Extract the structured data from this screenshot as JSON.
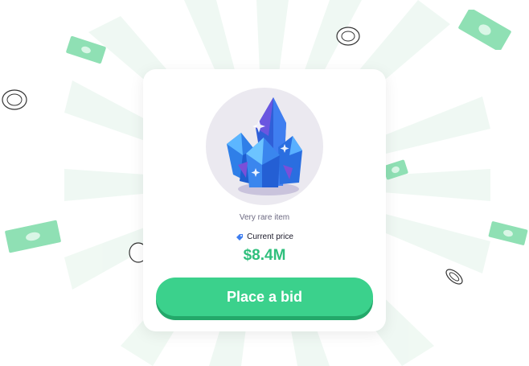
{
  "item": {
    "rarity_text": "Very rare item",
    "price_label": "Current price",
    "price_value": "$8.4M",
    "image_icon": "blue-crystal-icon",
    "tag_icon": "price-tag-icon"
  },
  "actions": {
    "bid_label": "Place a bid"
  },
  "colors": {
    "accent": "#3bd18c",
    "accent_dark": "#23a86a",
    "price": "#2fbf7c",
    "banknote": "#8fe0b4"
  },
  "decorations": {
    "background": "radial-light-rays",
    "banknote_icon": "banknote-icon",
    "coin_icon": "coin-icon"
  }
}
